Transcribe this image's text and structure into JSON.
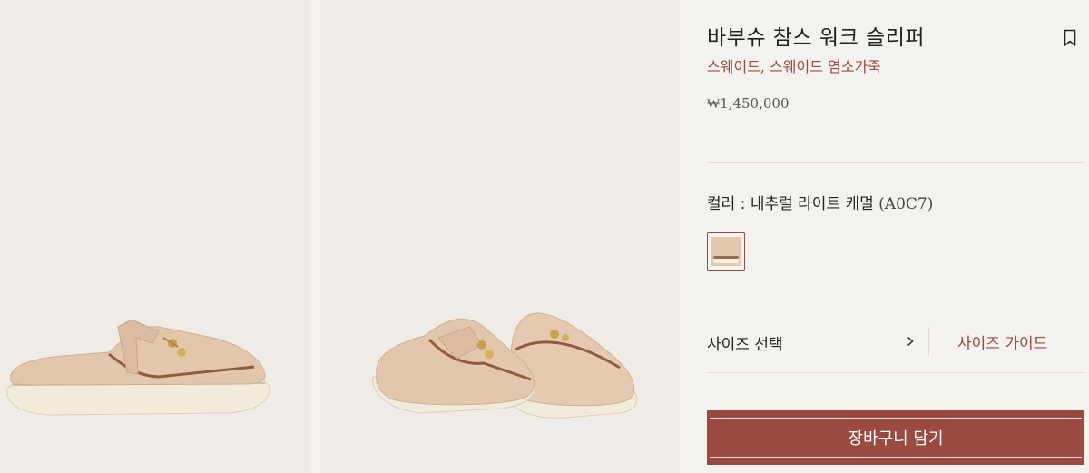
{
  "product": {
    "title": "바부슈 참스 워크 슬리퍼",
    "material": "스웨이드, 스웨이드 염소가죽",
    "price": "₩1,450,000"
  },
  "color": {
    "label": "컬러 : 내추럴 라이트 캐멀",
    "code": "(A0C7)",
    "swatch_color": "#e3c8b0"
  },
  "size": {
    "select_label": "사이즈 선택",
    "guide_label": "사이즈 가이드"
  },
  "cart": {
    "button_label": "장바구니 담기"
  },
  "colors": {
    "accent": "#9b4a3f",
    "background": "#f4f2ee",
    "photo_background": "#efebe6",
    "suede": "#e3c8b0"
  },
  "icons": {
    "bookmark": "bookmark-icon",
    "chevron": "chevron-right-icon"
  }
}
